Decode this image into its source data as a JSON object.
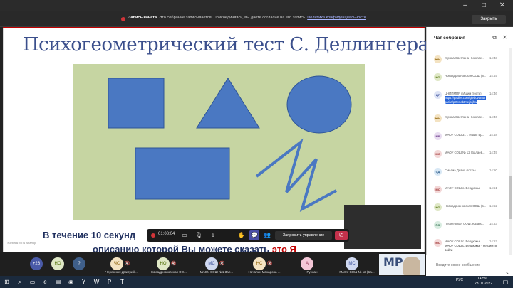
{
  "banner": {
    "title": "Запись начата.",
    "text": "Это собрание записывается. Присоединяясь, вы даете согласие на его запись.",
    "link": "Политика конфиденциальности",
    "close": "Закрыть"
  },
  "slide": {
    "title": "Психогеометрический тест С. Деллингера",
    "footer_line1": "В течение 10 секунд",
    "footer_line2a": "описанию которой Вы можете сказать",
    "footer_line2b": "это Я",
    "note": "Учебник МПЧ Аналор",
    "shape_color": "#4a78c2",
    "canvas_color": "#c6d5a2"
  },
  "toolbar": {
    "timer": "01:08:04",
    "request_control": "Запросить управление",
    "icons": [
      "camera-off-icon",
      "mic-off-icon",
      "share-icon",
      "more-icon",
      "raise-hand-icon",
      "chat-icon",
      "people-icon",
      "hangup-icon"
    ]
  },
  "chat": {
    "title": "Чат собрания",
    "messages": [
      {
        "initials": "ЮН",
        "name": "Юрова Светлана Николае...",
        "time": "14:43",
        "body": "",
        "color": "#f4e3c2",
        "fg": "#8a5c00"
      },
      {
        "initials": "НО",
        "name": "Новоадриановская ООШ (в...",
        "time": "14:45",
        "body": "",
        "color": "#dfe8c6",
        "fg": "#4a6a00"
      },
      {
        "initials": "ЦГ",
        "name": "ЦНППМПР г.Ишим (гость)",
        "time": "14:46",
        "body": "https://padlet.com/glebovamar garita/p3w1ebtmejbrjhw",
        "color": "#dde3f5",
        "fg": "#3a4f9a"
      },
      {
        "initials": "ЮН",
        "name": "Юрова Светлана Николае...",
        "time": "14:46",
        "body": "",
        "color": "#f4e3c2",
        "fg": "#8a5c00"
      },
      {
        "initials": "МР",
        "name": "МАОУ СОШ 31 г. Ишим Бр...",
        "time": "14:48",
        "body": "",
        "color": "#e8dcf0",
        "fg": "#6a3a8a"
      },
      {
        "initials": "МС",
        "name": "МАОУ СОШ № 12 (Балаев...",
        "time": "14:49",
        "body": "",
        "color": "#f3d8d8",
        "fg": "#9a2a2a"
      },
      {
        "initials": "СД",
        "name": "Смолиа Диана (гость)",
        "time": "14:50",
        "body": "",
        "color": "#d8e8f5",
        "fg": "#2a5a8a"
      },
      {
        "initials": "МС",
        "name": "МАОУ СОШ с. Бердюжье",
        "time": "14:51",
        "body": "",
        "color": "#f3d8d8",
        "fg": "#9a2a2a"
      },
      {
        "initials": "НО",
        "name": "Новоадриановская ООШ (в...",
        "time": "14:52",
        "body": "",
        "color": "#dfe8c6",
        "fg": "#4a6a00"
      },
      {
        "initials": "ПО",
        "name": "Пешневская ООШ, Казанс...",
        "time": "14:53",
        "body": "",
        "color": "#d8ece0",
        "fg": "#2a6a4a"
      },
      {
        "initials": "МС",
        "name": "МАОУ СОШ с. Бердюжье",
        "time": "14:53",
        "body": "МАОУ СОШ с. Бердюжье - не смогли войти",
        "color": "#f3d8d8",
        "fg": "#9a2a2a"
      }
    ],
    "input_placeholder": "Введите новое сообщение"
  },
  "participants": [
    {
      "initials": "+26",
      "name": "",
      "color": "#4a5aa8"
    },
    {
      "initials": "НО",
      "name": "",
      "color": "#dfe8c6"
    },
    {
      "initials": "?",
      "name": "",
      "color": "#3f5f8a"
    },
    {
      "initials": "ЧС",
      "name": "Черемных Дмитрий ...",
      "color": "#f4e3c2"
    },
    {
      "initials": "НО",
      "name": "Новоадриановская ОО...",
      "color": "#dfe8c6"
    },
    {
      "initials": "МС",
      "name": "МАОУ СОШ №1 Зал...",
      "color": "#cfd8f0"
    },
    {
      "initials": "НС",
      "name": "Начальн Макарова ...",
      "color": "#f4e3c2"
    },
    {
      "initials": "А",
      "name": "Руслан",
      "color": "#f3c6d6"
    },
    {
      "initials": "МС",
      "name": "МАОУ СОШ № 12 (Ба...",
      "color": "#cfd8f0"
    }
  ],
  "tile_logo": "МР",
  "taskbar": {
    "time": "14:59",
    "date": "23.01.2022",
    "lang": "РУС"
  }
}
